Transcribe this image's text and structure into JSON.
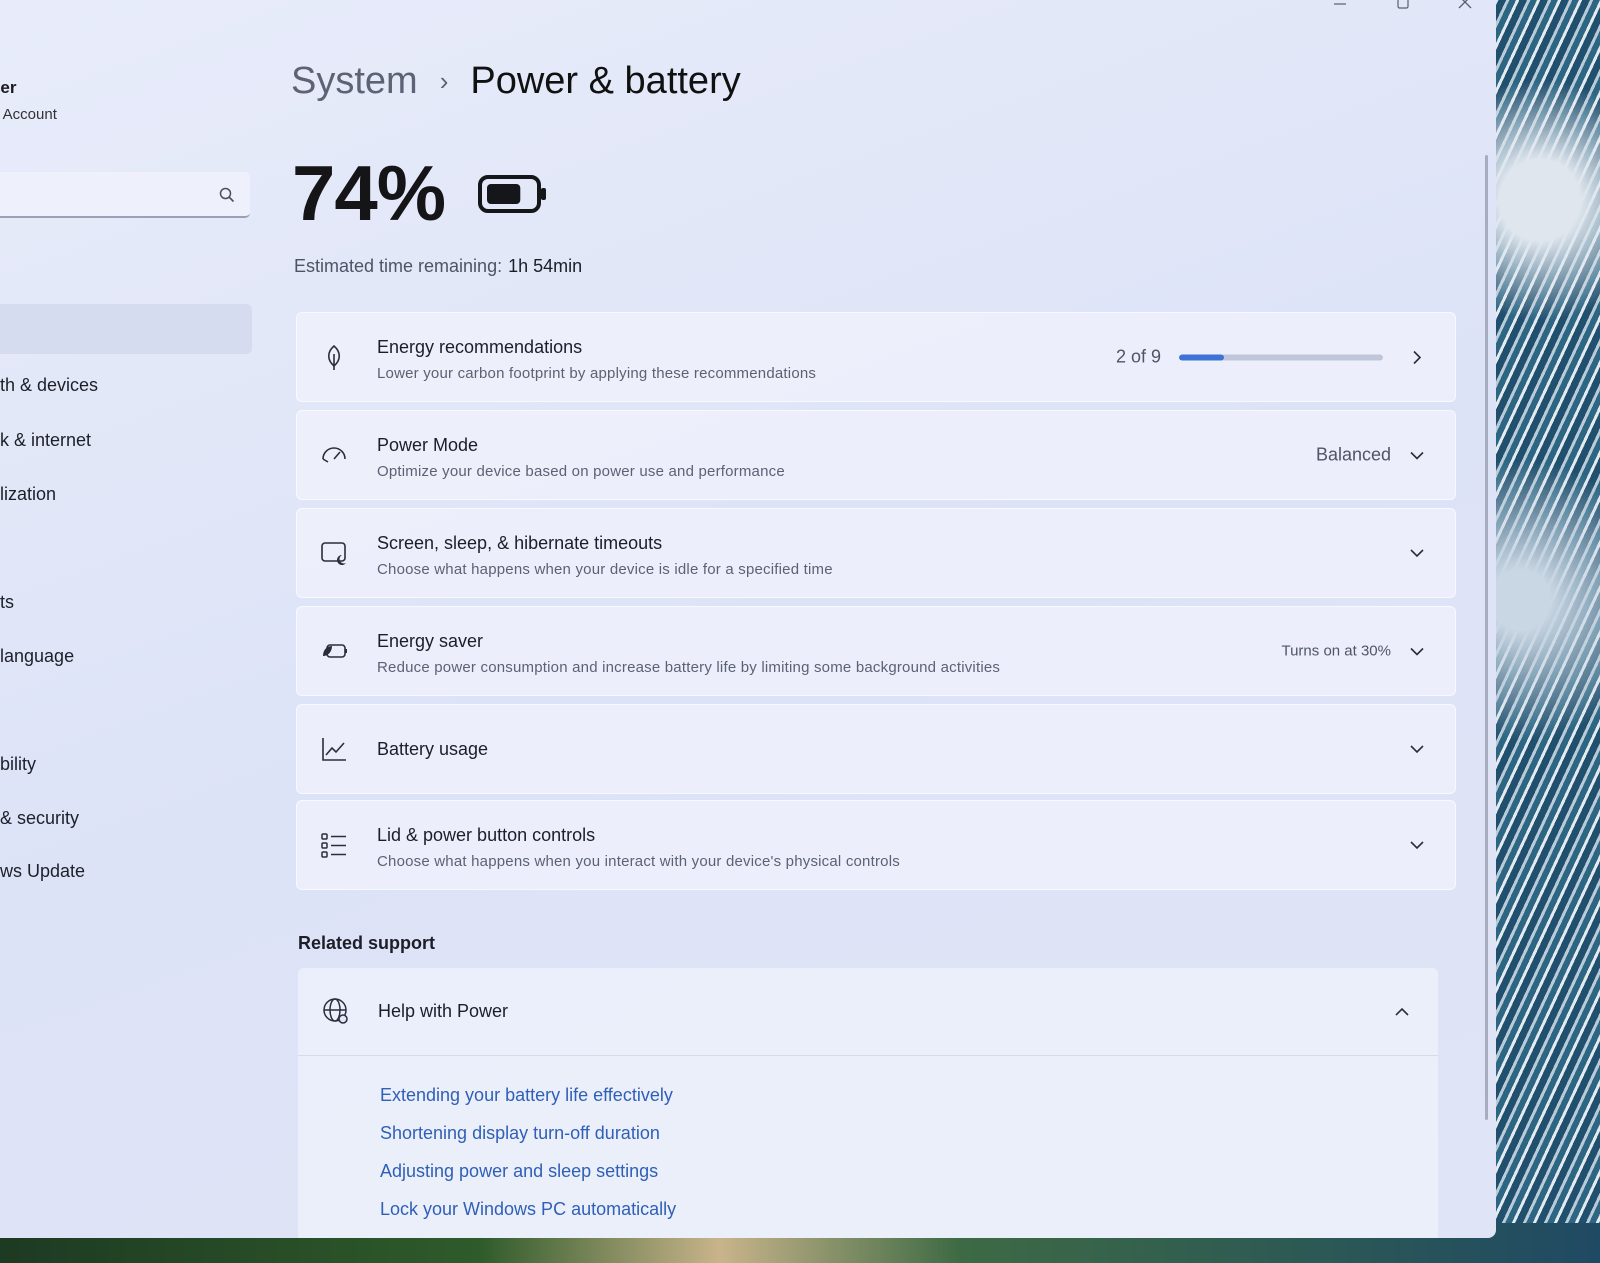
{
  "window": {
    "caption_buttons": [
      "minimize-icon",
      "maximize-icon",
      "close-icon"
    ]
  },
  "sidebar": {
    "user_name": "ner",
    "user_account": "l Account",
    "search": {
      "placeholder": "",
      "icon": "search-icon"
    },
    "items": [
      {
        "label": "th & devices"
      },
      {
        "label": "k & internet"
      },
      {
        "label": "lization"
      },
      {
        "label": "ts"
      },
      {
        "label": "language"
      },
      {
        "label": "bility"
      },
      {
        "label": "& security"
      },
      {
        "label": "ws Update"
      }
    ]
  },
  "header": {
    "parent": "System",
    "separator": "›",
    "current": "Power & battery"
  },
  "battery": {
    "percent": "74%",
    "level": 0.74,
    "estimate_label": "Estimated time remaining:",
    "estimate_value": "1h 54min"
  },
  "cards": [
    {
      "id": "energy-recommendations",
      "icon": "leaf-icon",
      "title": "Energy recommendations",
      "description": "Lower your carbon footprint by applying these recommendations",
      "value": "2 of 9",
      "progress": 0.22,
      "control": "chevron-right-icon"
    },
    {
      "id": "power-mode",
      "icon": "gauge-icon",
      "title": "Power Mode",
      "description": "Optimize your device based on power use and performance",
      "value": "Balanced",
      "control": "chevron-down-icon"
    },
    {
      "id": "screen-sleep",
      "icon": "screen-moon-icon",
      "title": "Screen, sleep, & hibernate timeouts",
      "description": "Choose what happens when your device is idle for a specified time",
      "control": "chevron-down-icon"
    },
    {
      "id": "energy-saver",
      "icon": "energy-saver-icon",
      "title": "Energy saver",
      "description": "Reduce power consumption and increase battery life by limiting some background activities",
      "value": "Turns on at 30%",
      "control": "chevron-down-icon"
    },
    {
      "id": "battery-usage",
      "icon": "line-chart-icon",
      "title": "Battery usage",
      "control": "chevron-down-icon"
    },
    {
      "id": "lid-power",
      "icon": "list-settings-icon",
      "title": "Lid & power button controls",
      "description": "Choose what happens when you interact with your device's physical controls",
      "control": "chevron-down-icon"
    }
  ],
  "related": {
    "label": "Related support",
    "help": {
      "icon": "globe-icon",
      "title": "Help with Power",
      "control": "chevron-up-icon",
      "links": [
        "Extending your battery life effectively",
        "Shortening display turn-off duration",
        "Adjusting power and sleep settings",
        "Lock your Windows PC automatically"
      ]
    }
  },
  "colors": {
    "accent": "#3d73d6",
    "link": "#2f5fb7",
    "window_bg": "#e3e8f8"
  }
}
